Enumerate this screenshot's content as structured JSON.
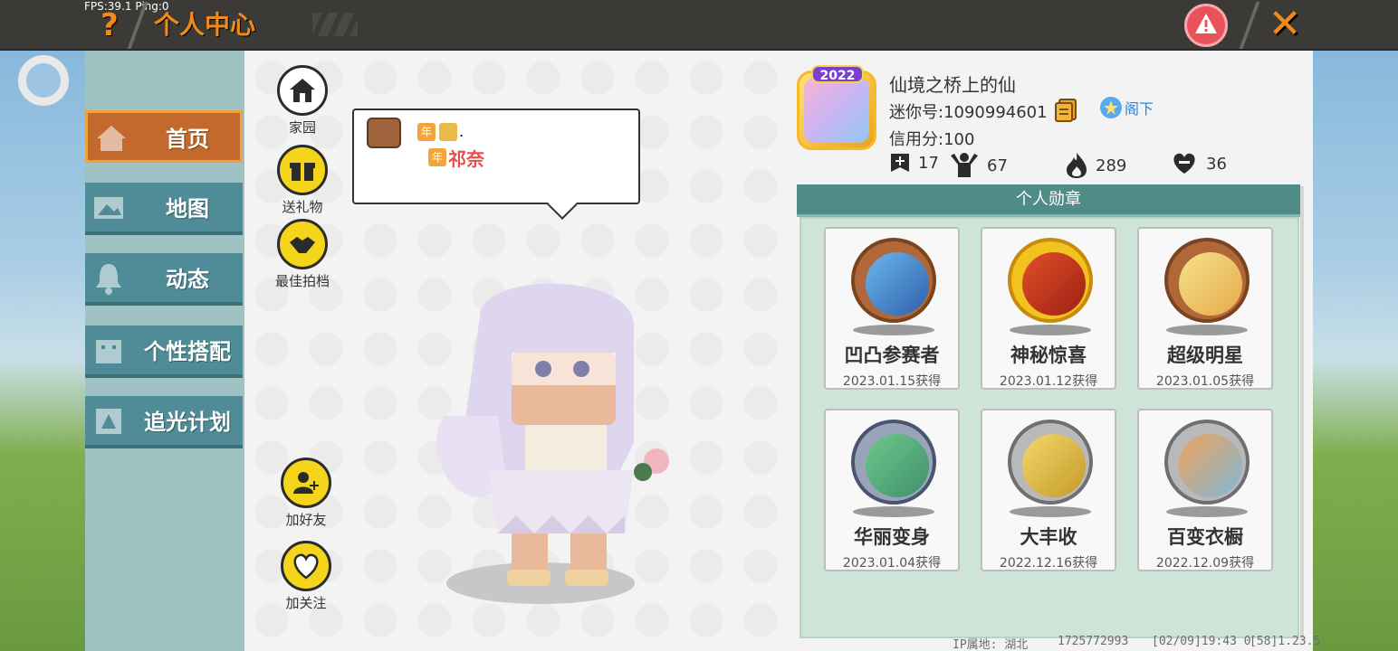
{
  "hud": {
    "fps": "FPS:39.1",
    "ping": "Ping:0"
  },
  "header": {
    "title": "个人中心",
    "help": "?",
    "close": "✕"
  },
  "sidebar": {
    "items": [
      {
        "label": "首页",
        "icon": "house-icon",
        "active": true
      },
      {
        "label": "地图",
        "icon": "picture-icon",
        "active": false
      },
      {
        "label": "动态",
        "icon": "bell-icon",
        "active": false
      },
      {
        "label": "个性搭配",
        "icon": "outfit-icon",
        "active": false
      },
      {
        "label": "追光计划",
        "icon": "light-plan-icon",
        "active": false
      }
    ]
  },
  "actions": {
    "home": "家园",
    "gift": "送礼物",
    "partner": "最佳拍档",
    "add_friend": "加好友",
    "follow": "加关注"
  },
  "speech": {
    "tag1": "年",
    "tag2": "年",
    "dot": ".",
    "name": "祁奈"
  },
  "profile": {
    "year_badge": "2022",
    "name": "仙境之桥上的仙",
    "id": "迷你号:1090994601",
    "rank": "阁下",
    "credit": "信用分:100",
    "stats": {
      "posts": "17",
      "fans": "67",
      "popularity": "289",
      "likes": "36"
    }
  },
  "badges": {
    "header": "个人勋章",
    "items": [
      {
        "name": "凹凸参赛者",
        "date": "2023.01.15获得",
        "tier": "bronze"
      },
      {
        "name": "神秘惊喜",
        "date": "2023.01.12获得",
        "tier": "gold"
      },
      {
        "name": "超级明星",
        "date": "2023.01.05获得",
        "tier": "bronze"
      },
      {
        "name": "华丽变身",
        "date": "2023.01.04获得",
        "tier": "silver"
      },
      {
        "name": "大丰收",
        "date": "2022.12.16获得",
        "tier": "silver"
      },
      {
        "name": "百变衣橱",
        "date": "2022.12.09获得",
        "tier": "silver"
      }
    ]
  },
  "footer": {
    "ip": "IP属地: 湖北",
    "uid": "1725772993",
    "time": "[02/09]19:43 0",
    "version": "[58]1.23.5"
  },
  "colors": {
    "accent": "#f08a1c",
    "menu_bg": "#4f8c97",
    "menu_active": "#c3692e",
    "badge_header": "#4f8c88",
    "rank_blue": "#2a86d8",
    "name_red": "#e84d4d"
  }
}
